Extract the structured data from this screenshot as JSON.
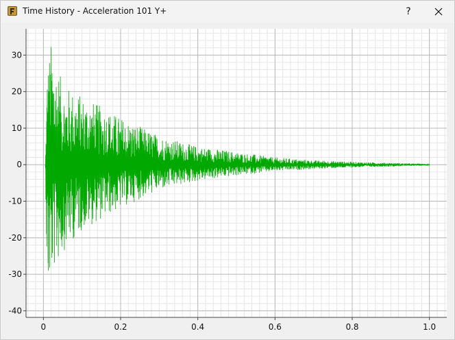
{
  "window": {
    "title": "Time History - Acceleration 101 Y+",
    "help_label": "?",
    "close_icon": "close-icon",
    "app_icon": "app-icon"
  },
  "colors": {
    "signal": "#00a800",
    "plot_bg": "#ffffff",
    "major_grid": "#b8b8b8",
    "minor_grid": "#e6e6e6",
    "axis": "#444444"
  },
  "chart_data": {
    "type": "line",
    "title": "",
    "xlabel": "",
    "ylabel": "",
    "xlim": [
      -0.045,
      1.045
    ],
    "ylim": [
      -41.8,
      37.2
    ],
    "x_ticks": [
      0,
      0.2,
      0.4,
      0.6,
      0.8,
      1.0
    ],
    "x_tick_labels": [
      "0",
      "0.2",
      "0.4",
      "0.6",
      "0.8",
      "1.0"
    ],
    "y_ticks": [
      -40,
      -30,
      -20,
      -10,
      0,
      10,
      20,
      30
    ],
    "y_tick_labels": [
      "-40",
      "-30",
      "-20",
      "-10",
      "0",
      "10",
      "20",
      "30"
    ],
    "grid": true,
    "legend": "none",
    "series": [
      {
        "envelope": {
          "description_points_t": [
            0.0,
            0.005,
            0.01,
            0.02,
            0.05,
            0.1,
            0.2,
            0.3,
            0.4,
            0.5,
            0.6,
            0.7,
            0.8,
            0.9,
            1.0
          ],
          "upper": [
            0,
            0,
            28,
            33.5,
            22,
            19,
            13,
            8,
            5,
            3.5,
            2,
            1.2,
            0.8,
            0.5,
            0.2
          ],
          "lower": [
            0,
            0,
            -38.5,
            -31,
            -24,
            -18,
            -12,
            -7,
            -4.5,
            -3,
            -1.8,
            -1.2,
            -0.8,
            -0.5,
            -0.2
          ]
        },
        "x_start": 0.005,
        "x_end": 1.0
      }
    ]
  }
}
